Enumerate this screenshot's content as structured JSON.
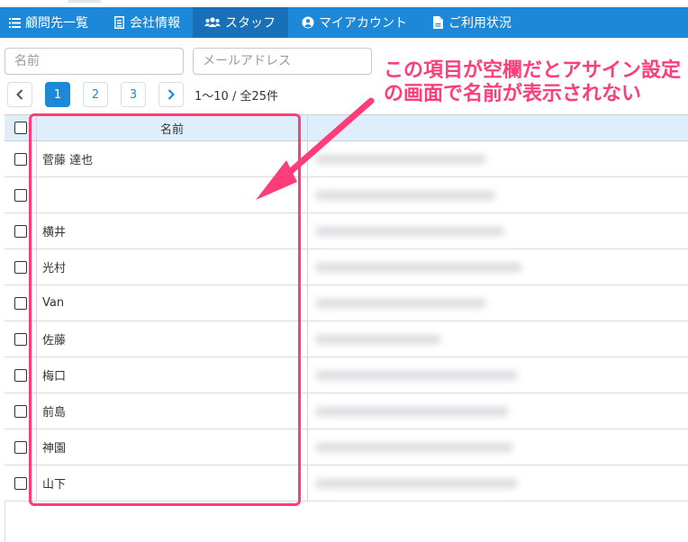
{
  "nav": {
    "items": [
      {
        "label": "顧問先一覧",
        "icon": "list-icon",
        "active": false
      },
      {
        "label": "会社情報",
        "icon": "document-icon",
        "active": false
      },
      {
        "label": "スタッフ",
        "icon": "users-icon",
        "active": true
      },
      {
        "label": "マイアカウント",
        "icon": "user-circle-icon",
        "active": false
      },
      {
        "label": "ご利用状況",
        "icon": "file-icon",
        "active": false
      }
    ]
  },
  "filters": {
    "name_placeholder": "名前",
    "email_placeholder": "メールアドレス"
  },
  "pagination": {
    "prev_icon": "chevron-left-icon",
    "next_icon": "chevron-right-icon",
    "pages": [
      "1",
      "2",
      "3"
    ],
    "current": "1",
    "range_text": "1〜10 / 全25件"
  },
  "table": {
    "name_header": "名前",
    "rows": [
      {
        "name": "菅藤 達也"
      },
      {
        "name": ""
      },
      {
        "name": "横井"
      },
      {
        "name": "光村"
      },
      {
        "name": "Van"
      },
      {
        "name": "佐藤"
      },
      {
        "name": "梅口"
      },
      {
        "name": "前島"
      },
      {
        "name": "神園"
      },
      {
        "name": "山下"
      }
    ]
  },
  "annotation": {
    "text": "この項目が空欄だとアサイン設定の画面で名前が表示されない",
    "color": "#ff3d7a"
  },
  "colors": {
    "navbar": "#1e88d8",
    "navbar_active": "#1770b8",
    "header_row": "#deeefa"
  }
}
